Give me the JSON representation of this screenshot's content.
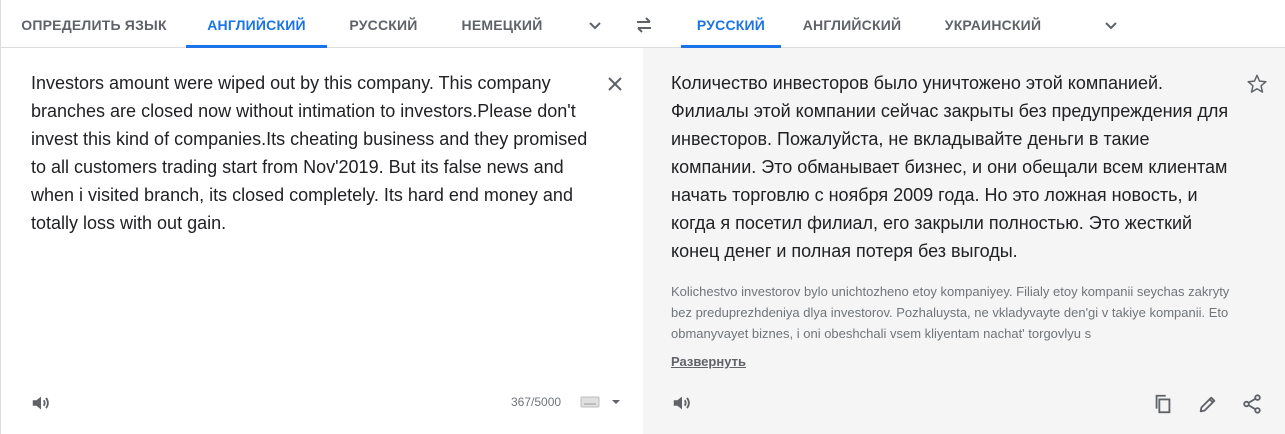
{
  "source_langs": {
    "detect": "ОПРЕДЕЛИТЬ ЯЗЫК",
    "items": [
      "АНГЛИЙСКИЙ",
      "РУССКИЙ",
      "НЕМЕЦКИЙ"
    ],
    "selected": "АНГЛИЙСКИЙ"
  },
  "target_langs": {
    "items": [
      "РУССКИЙ",
      "АНГЛИЙСКИЙ",
      "УКРАИНСКИЙ"
    ],
    "selected": "РУССКИЙ"
  },
  "source": {
    "text": "Investors amount were wiped out by this company. This company branches are closed now without intimation to investors.Please don't invest this kind of companies.Its cheating business and they promised to all customers trading start from Nov'2019. But its false news and when i visited branch, its closed completely. Its hard end money and totally loss with out gain.",
    "char_count": "367/5000"
  },
  "target": {
    "text": "Количество инвесторов было уничтожено этой компанией. Филиалы этой компании сейчас закрыты без предупреждения для инвесторов. Пожалуйста, не вкладывайте деньги в такие компании. Это обманывает бизнес, и они обещали всем клиентам начать торговлю с ноября 2009 года. Но это ложная новость, и когда я посетил филиал, его закрыли полностью. Это жесткий конец денег и полная потеря без выгоды.",
    "transliteration": "Kolichestvo investorov bylo unichtozheno etoy kompaniyey. Filialy etoy kompanii seychas zakryty bez preduprezhdeniya dlya investorov. Pozhaluysta, ne vkladyvayte den'gi v takiye kompanii. Eto obmanyvayet biznes, i oni obeshchali vsem kliyentam nachat' torgovlyu s",
    "expand_label": "Развернуть"
  },
  "icons": {
    "source_more": "chevron-down-icon",
    "swap": "swap-icon",
    "target_more": "chevron-down-icon",
    "clear": "close-icon",
    "star": "star-icon",
    "listen": "speaker-icon",
    "keyboard": "keyboard-icon",
    "copy": "copy-icon",
    "edit": "pencil-icon",
    "share": "share-icon"
  },
  "colors": {
    "accent": "#1a73e8",
    "tab_text": "#5f6368",
    "target_bg": "#f5f5f5"
  }
}
